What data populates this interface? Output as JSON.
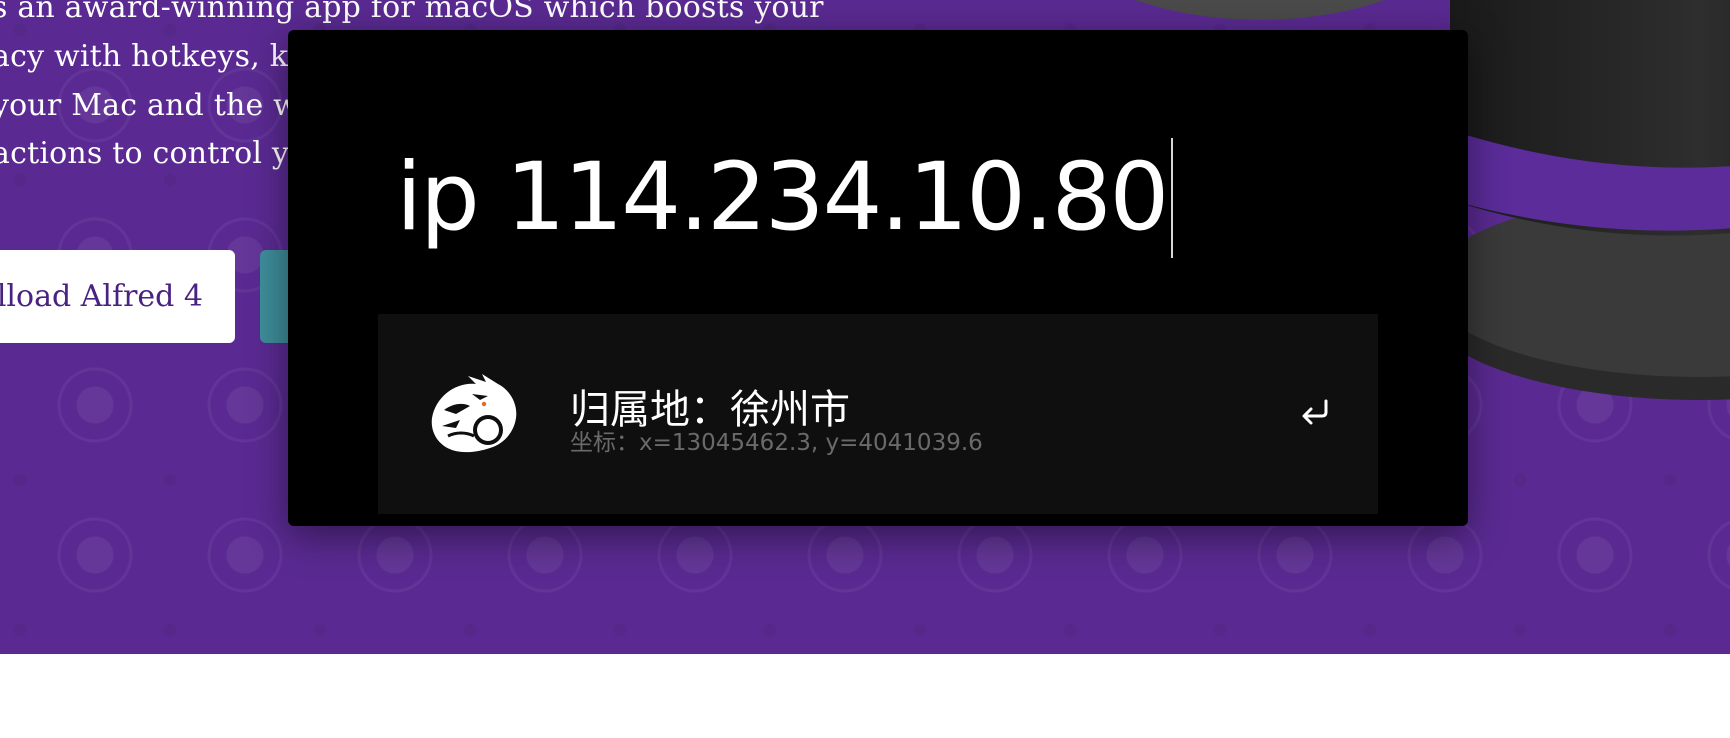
{
  "website": {
    "intro_lines": [
      "s an award-winning app for macOS which boosts your",
      "acy with hotkeys, ke",
      "your Mac and the w",
      " actions to control y"
    ],
    "download_button": "lload Alfred 4",
    "colors": {
      "background": "#5a2a92",
      "download_button_text": "#4a2282",
      "secondary_button": "#3f8e9c"
    }
  },
  "alfred": {
    "query": "ip 114.234.10.80",
    "results": [
      {
        "title": "归属地：徐州市",
        "subtitle": "坐标：x=13045462.3, y=4041039.6",
        "icon": "lion-icon",
        "action_icon": "enter-icon"
      }
    ],
    "colors": {
      "window": "#000000",
      "result_background": "#0f0f0f",
      "title": "#ffffff",
      "subtitle": "#6a6a6a"
    }
  }
}
